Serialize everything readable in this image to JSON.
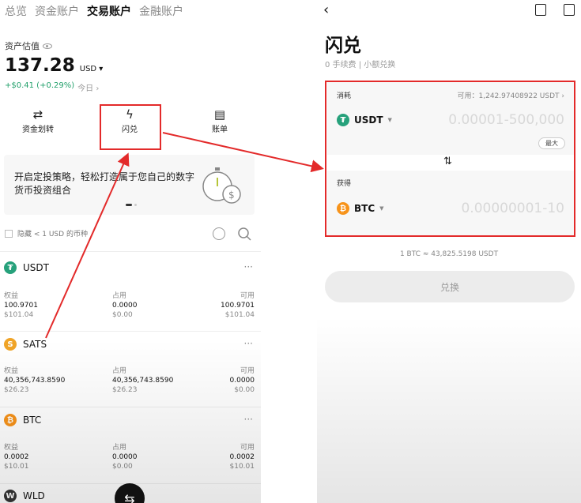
{
  "left": {
    "tabs": [
      "总览",
      "资金账户",
      "交易账户",
      "金融账户"
    ],
    "active_tab": "交易账户",
    "asset_label": "资产估值",
    "balance": "137.28",
    "balance_unit": "USD ▾",
    "pnl": "+$0.41 (+0.29%)",
    "pnl_period": "今日 ›",
    "actions": [
      {
        "label": "资金划转",
        "icon": "⇄"
      },
      {
        "label": "闪兑",
        "icon": "ϟ"
      },
      {
        "label": "账单",
        "icon": "▤"
      }
    ],
    "banner": {
      "text": "开启定投策略，轻松打造属于您自己的数字货币投资组合",
      "icon": "stopwatch-dollar-icon"
    },
    "hide_small": "隐藏 < 1 USD 的币种",
    "columns": [
      "权益",
      "占用",
      "可用"
    ],
    "coins": [
      {
        "name": "USDT",
        "symbol": "₮",
        "color": "#26a17b",
        "equity": "100.9701",
        "equity_usd": "$101.04",
        "occupied": "0.0000",
        "occupied_usd": "$0.00",
        "available": "100.9701",
        "available_usd": "$101.04"
      },
      {
        "name": "SATS",
        "symbol": "S",
        "color": "#f0a427",
        "equity": "40,356,743.8590",
        "equity_usd": "$26.23",
        "occupied": "40,356,743.8590",
        "occupied_usd": "$26.23",
        "available": "0.0000",
        "available_usd": "$0.00"
      },
      {
        "name": "BTC",
        "symbol": "₿",
        "color": "#f7931a",
        "equity": "0.0002",
        "equity_usd": "$10.01",
        "occupied": "0.0000",
        "occupied_usd": "$0.00",
        "available": "0.0002",
        "available_usd": "$10.01"
      }
    ],
    "partial_coin": "WLD"
  },
  "right": {
    "title": "闪兑",
    "subtitle": "0 手续费 | 小额兑换",
    "consume_label": "消耗",
    "available": "可用：1,242.97408922 USDT ›",
    "from_token": "USDT",
    "from_placeholder": "0.00001-500,000",
    "max_label": "最大",
    "receive_label": "获得",
    "to_token": "BTC",
    "to_placeholder": "0.00000001-10",
    "rate": "1 BTC ≈ 43,825.5198 USDT",
    "convert_button": "兑换",
    "colors": {
      "usdt": "#26a17b",
      "btc": "#f7931a",
      "annotation": "#e32a2a"
    }
  }
}
